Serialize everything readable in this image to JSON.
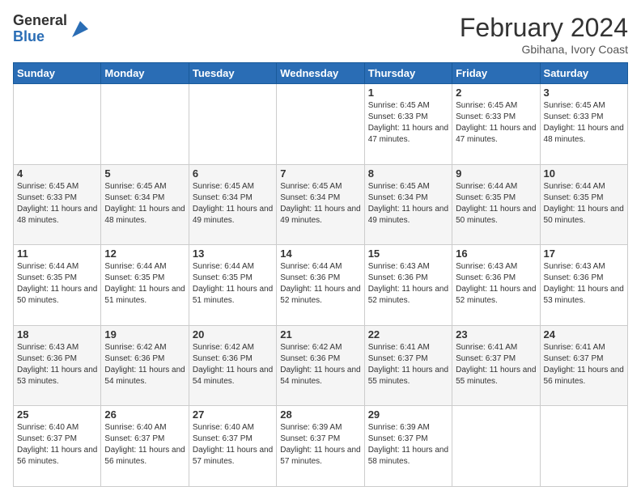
{
  "header": {
    "logo_general": "General",
    "logo_blue": "Blue",
    "month_title": "February 2024",
    "location": "Gbihana, Ivory Coast"
  },
  "days_of_week": [
    "Sunday",
    "Monday",
    "Tuesday",
    "Wednesday",
    "Thursday",
    "Friday",
    "Saturday"
  ],
  "weeks": [
    [
      {
        "day": "",
        "info": ""
      },
      {
        "day": "",
        "info": ""
      },
      {
        "day": "",
        "info": ""
      },
      {
        "day": "",
        "info": ""
      },
      {
        "day": "1",
        "info": "Sunrise: 6:45 AM\nSunset: 6:33 PM\nDaylight: 11 hours and 47 minutes."
      },
      {
        "day": "2",
        "info": "Sunrise: 6:45 AM\nSunset: 6:33 PM\nDaylight: 11 hours and 47 minutes."
      },
      {
        "day": "3",
        "info": "Sunrise: 6:45 AM\nSunset: 6:33 PM\nDaylight: 11 hours and 48 minutes."
      }
    ],
    [
      {
        "day": "4",
        "info": "Sunrise: 6:45 AM\nSunset: 6:33 PM\nDaylight: 11 hours and 48 minutes."
      },
      {
        "day": "5",
        "info": "Sunrise: 6:45 AM\nSunset: 6:34 PM\nDaylight: 11 hours and 48 minutes."
      },
      {
        "day": "6",
        "info": "Sunrise: 6:45 AM\nSunset: 6:34 PM\nDaylight: 11 hours and 49 minutes."
      },
      {
        "day": "7",
        "info": "Sunrise: 6:45 AM\nSunset: 6:34 PM\nDaylight: 11 hours and 49 minutes."
      },
      {
        "day": "8",
        "info": "Sunrise: 6:45 AM\nSunset: 6:34 PM\nDaylight: 11 hours and 49 minutes."
      },
      {
        "day": "9",
        "info": "Sunrise: 6:44 AM\nSunset: 6:35 PM\nDaylight: 11 hours and 50 minutes."
      },
      {
        "day": "10",
        "info": "Sunrise: 6:44 AM\nSunset: 6:35 PM\nDaylight: 11 hours and 50 minutes."
      }
    ],
    [
      {
        "day": "11",
        "info": "Sunrise: 6:44 AM\nSunset: 6:35 PM\nDaylight: 11 hours and 50 minutes."
      },
      {
        "day": "12",
        "info": "Sunrise: 6:44 AM\nSunset: 6:35 PM\nDaylight: 11 hours and 51 minutes."
      },
      {
        "day": "13",
        "info": "Sunrise: 6:44 AM\nSunset: 6:35 PM\nDaylight: 11 hours and 51 minutes."
      },
      {
        "day": "14",
        "info": "Sunrise: 6:44 AM\nSunset: 6:36 PM\nDaylight: 11 hours and 52 minutes."
      },
      {
        "day": "15",
        "info": "Sunrise: 6:43 AM\nSunset: 6:36 PM\nDaylight: 11 hours and 52 minutes."
      },
      {
        "day": "16",
        "info": "Sunrise: 6:43 AM\nSunset: 6:36 PM\nDaylight: 11 hours and 52 minutes."
      },
      {
        "day": "17",
        "info": "Sunrise: 6:43 AM\nSunset: 6:36 PM\nDaylight: 11 hours and 53 minutes."
      }
    ],
    [
      {
        "day": "18",
        "info": "Sunrise: 6:43 AM\nSunset: 6:36 PM\nDaylight: 11 hours and 53 minutes."
      },
      {
        "day": "19",
        "info": "Sunrise: 6:42 AM\nSunset: 6:36 PM\nDaylight: 11 hours and 54 minutes."
      },
      {
        "day": "20",
        "info": "Sunrise: 6:42 AM\nSunset: 6:36 PM\nDaylight: 11 hours and 54 minutes."
      },
      {
        "day": "21",
        "info": "Sunrise: 6:42 AM\nSunset: 6:36 PM\nDaylight: 11 hours and 54 minutes."
      },
      {
        "day": "22",
        "info": "Sunrise: 6:41 AM\nSunset: 6:37 PM\nDaylight: 11 hours and 55 minutes."
      },
      {
        "day": "23",
        "info": "Sunrise: 6:41 AM\nSunset: 6:37 PM\nDaylight: 11 hours and 55 minutes."
      },
      {
        "day": "24",
        "info": "Sunrise: 6:41 AM\nSunset: 6:37 PM\nDaylight: 11 hours and 56 minutes."
      }
    ],
    [
      {
        "day": "25",
        "info": "Sunrise: 6:40 AM\nSunset: 6:37 PM\nDaylight: 11 hours and 56 minutes."
      },
      {
        "day": "26",
        "info": "Sunrise: 6:40 AM\nSunset: 6:37 PM\nDaylight: 11 hours and 56 minutes."
      },
      {
        "day": "27",
        "info": "Sunrise: 6:40 AM\nSunset: 6:37 PM\nDaylight: 11 hours and 57 minutes."
      },
      {
        "day": "28",
        "info": "Sunrise: 6:39 AM\nSunset: 6:37 PM\nDaylight: 11 hours and 57 minutes."
      },
      {
        "day": "29",
        "info": "Sunrise: 6:39 AM\nSunset: 6:37 PM\nDaylight: 11 hours and 58 minutes."
      },
      {
        "day": "",
        "info": ""
      },
      {
        "day": "",
        "info": ""
      }
    ]
  ]
}
